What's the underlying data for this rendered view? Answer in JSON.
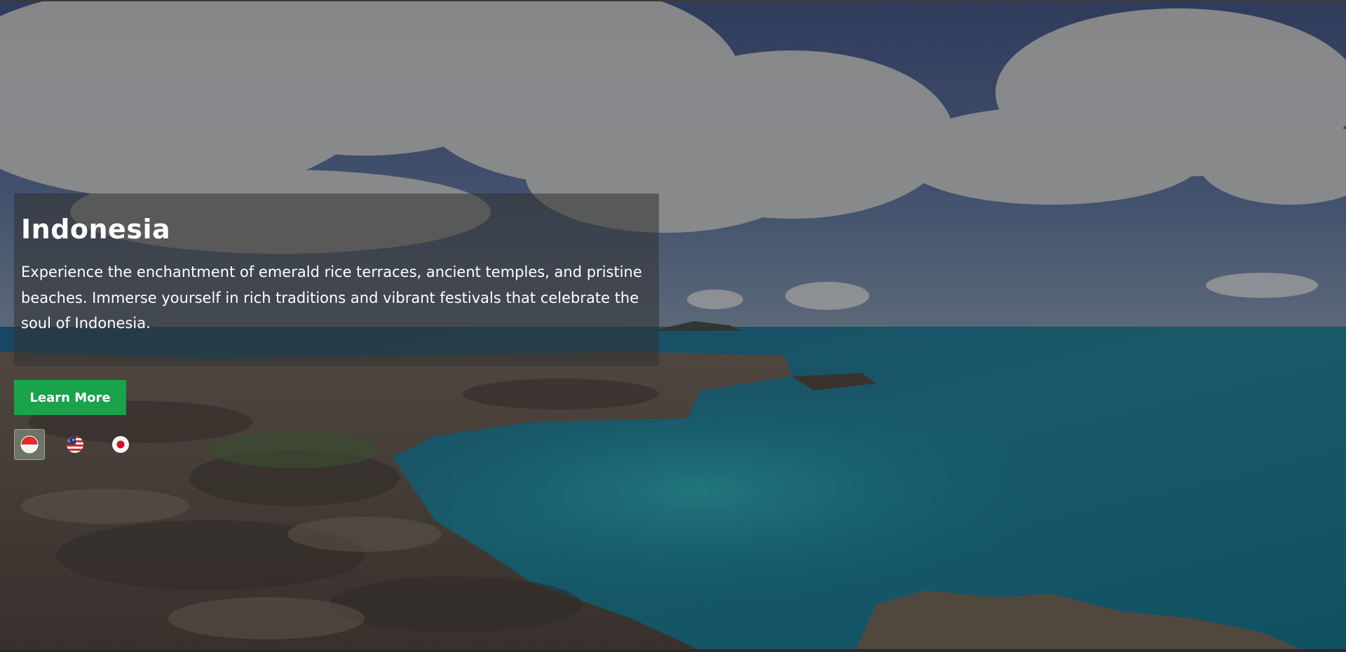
{
  "hero": {
    "title": "Indonesia",
    "description": "Experience the enchantment of emerald rice terraces, ancient temples, and pristine beaches. Immerse yourself in rich traditions and vibrant festivals that celebrate the soul of Indonesia.",
    "cta_label": "Learn More",
    "accent_color": "#19a34a"
  },
  "destinations": [
    {
      "name": "Indonesia",
      "icon": "indonesia-flag-icon",
      "active": true
    },
    {
      "name": "Malaysia",
      "icon": "malaysia-flag-icon",
      "active": false
    },
    {
      "name": "Japan",
      "icon": "japan-flag-icon",
      "active": false
    }
  ]
}
